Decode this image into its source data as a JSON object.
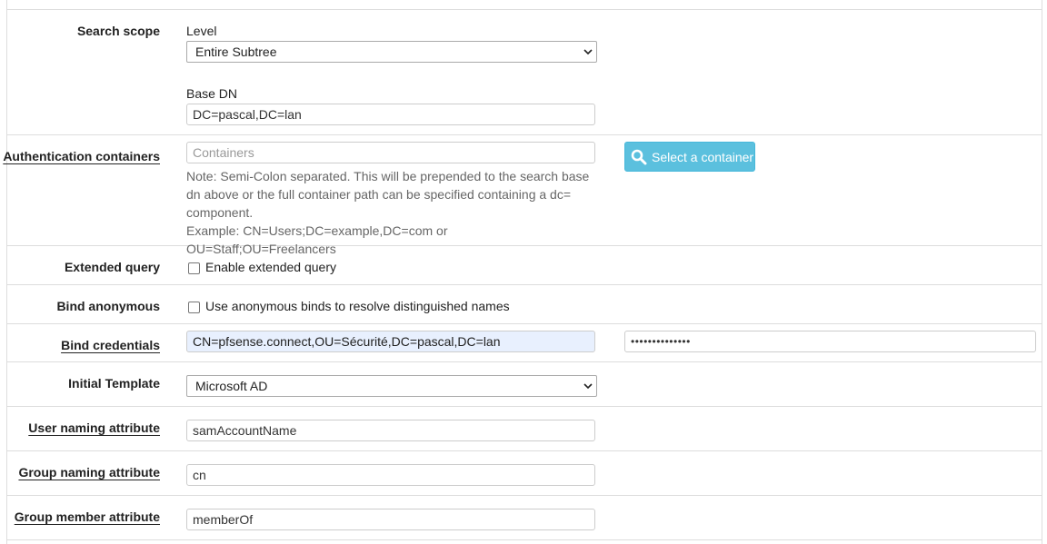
{
  "search_scope": {
    "label": "Search scope",
    "level_label": "Level",
    "level_value": "Entire Subtree",
    "base_dn_label": "Base DN",
    "base_dn_value": "DC=pascal,DC=lan"
  },
  "auth_containers": {
    "label": "Authentication containers",
    "placeholder": "Containers",
    "button_label": "Select a container",
    "note_line1": "Note: Semi-Colon separated. This will be prepended to the search base",
    "note_line2": "dn above or the full container path can be specified containing a dc=",
    "note_line3": "component.",
    "note_line4": "Example: CN=Users;DC=example,DC=com or OU=Staff;OU=Freelancers"
  },
  "extended_query": {
    "label": "Extended query",
    "checkbox_label": "Enable extended query",
    "checked": false
  },
  "bind_anonymous": {
    "label": "Bind anonymous",
    "checkbox_label": "Use anonymous binds to resolve distinguished names",
    "checked": false
  },
  "bind_credentials": {
    "label": "Bind credentials",
    "user_value": "CN=pfsense.connect,OU=Sécurité,DC=pascal,DC=lan",
    "password_mask": "••••••••••••••"
  },
  "initial_template": {
    "label": "Initial Template",
    "value": "Microsoft AD"
  },
  "user_naming": {
    "label": "User naming attribute",
    "value": "samAccountName"
  },
  "group_naming": {
    "label": "Group naming attribute",
    "value": "cn"
  },
  "group_member": {
    "label": "Group member attribute",
    "value": "memberOf"
  },
  "colors": {
    "button_bg": "#5bc0de",
    "border": "#dddddd",
    "autofill_bg": "#e8f0fe"
  },
  "icons": {
    "search": "search-icon",
    "dropdown": "chevron-down-icon"
  }
}
